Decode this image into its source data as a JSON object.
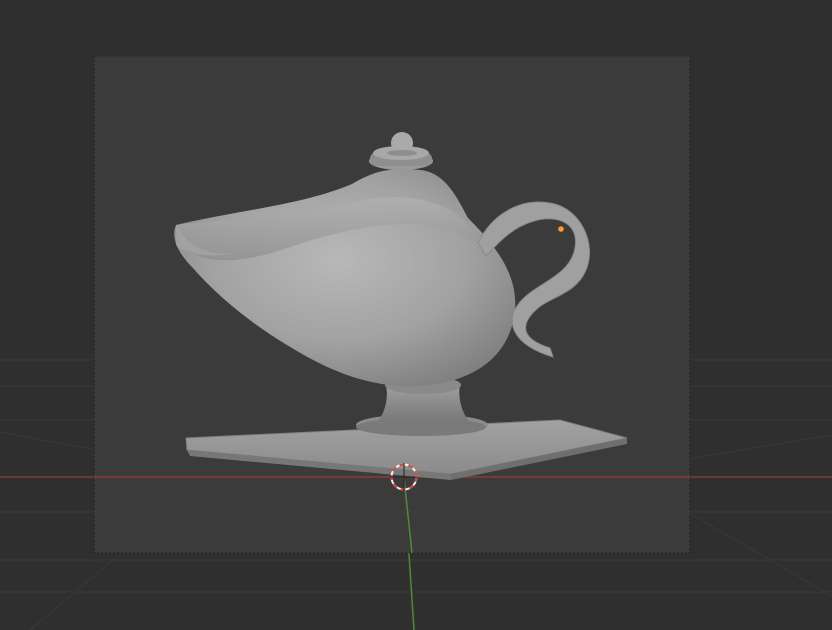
{
  "viewport": {
    "background_color": "#2f2f2f",
    "camera_frame_fill": "#3b3b3b",
    "grid_line_color": "#3a3a3a",
    "x_axis_color": "#8a3a3a",
    "y_axis_color": "#4f8a3a",
    "object_color": "#9e9e9e",
    "selected_point_color": "#ff9a2a"
  },
  "icons": {
    "cursor": "3d-cursor-icon",
    "origin": "object-origin-icon"
  }
}
